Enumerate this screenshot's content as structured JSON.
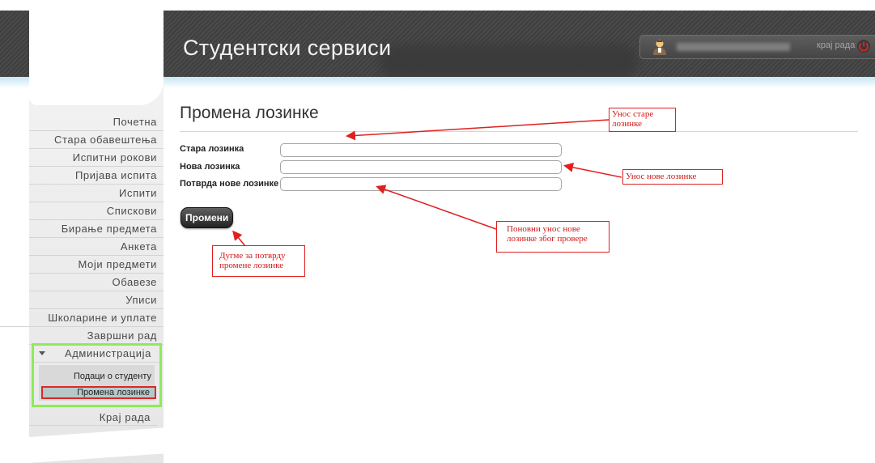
{
  "header": {
    "app_title": "Студентски сервиси",
    "logout_label": "крај рада",
    "colors": {
      "bar": "#444444",
      "power_icon": "#e02020"
    },
    "icons": {
      "avatar": "user-avatar-icon",
      "logout": "power-icon"
    }
  },
  "sidebar": {
    "items": [
      {
        "label": "Почетна"
      },
      {
        "label": "Стара обавештења"
      },
      {
        "label": "Испитни рокови"
      },
      {
        "label": "Пријава испита"
      },
      {
        "label": "Испити"
      },
      {
        "label": "Спискови"
      },
      {
        "label": "Бирање предмета"
      },
      {
        "label": "Анкета"
      },
      {
        "label": "Моји предмети"
      },
      {
        "label": "Обавезе"
      },
      {
        "label": "Уписи"
      },
      {
        "label": "Школарине и уплате"
      },
      {
        "label": "Завршни рад"
      }
    ],
    "admin": {
      "label": "Администрација",
      "subitems": [
        {
          "label": "Подаци о студенту"
        },
        {
          "label": "Промена лозинке",
          "selected": true
        }
      ],
      "highlight_color": "#8eea5a"
    },
    "end_item": "Крај рада"
  },
  "main": {
    "title": "Промена лозинке",
    "fields": [
      {
        "label": "Стара лозинка",
        "value": ""
      },
      {
        "label": "Нова лозинка",
        "value": ""
      },
      {
        "label": "Потврда нове лозинке",
        "value": ""
      }
    ],
    "submit_label": "Промени"
  },
  "annotations": {
    "old_password_line1": "Унос старе",
    "old_password_line2": "лозинке",
    "new_password": "Унос нове лозинке",
    "confirm_line1": "Поновни унос нове",
    "confirm_line2": "лозинке због провере",
    "button_line1": "Дугме за потврду",
    "button_line2": "промене лозинке",
    "color": "#e02020"
  }
}
